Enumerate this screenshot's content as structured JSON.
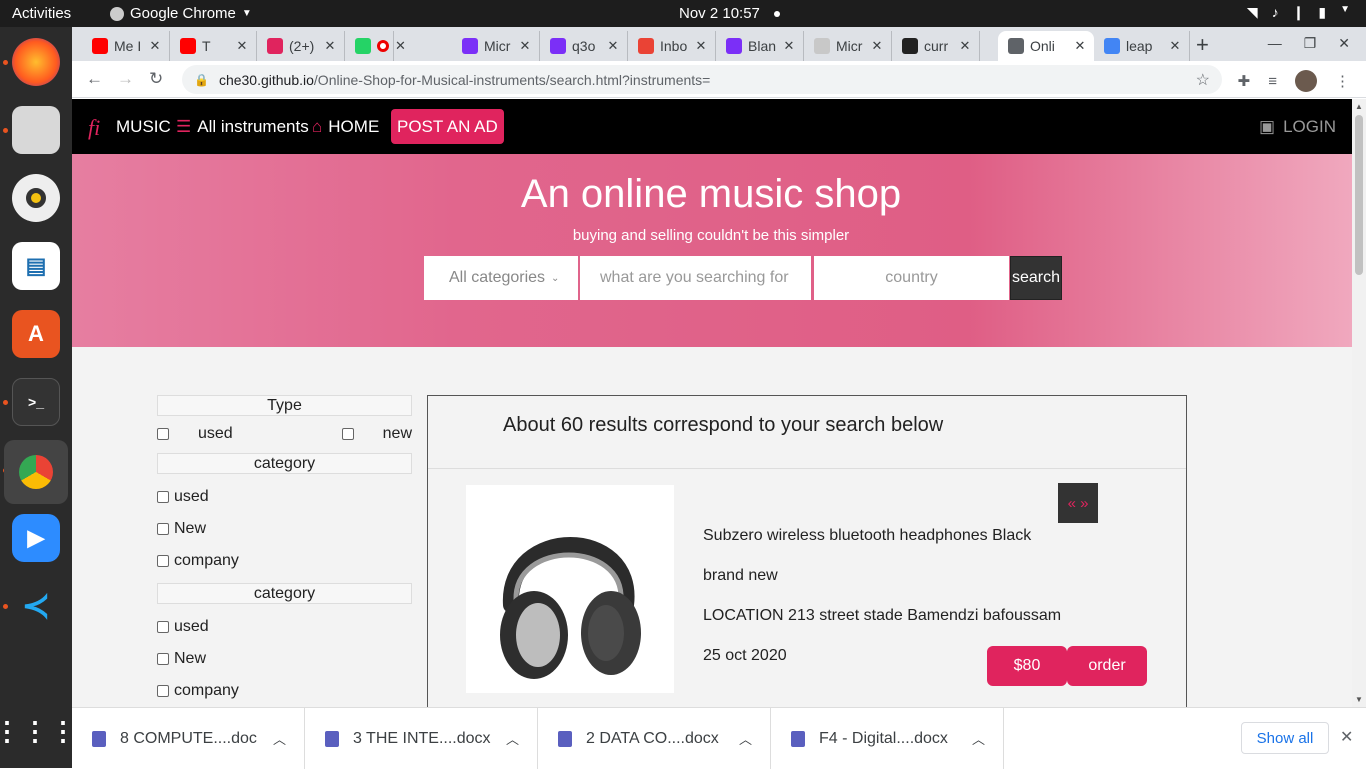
{
  "os": {
    "activities": "Activities",
    "app_name": "Google Chrome",
    "clock": "Nov 2  10:57"
  },
  "browser": {
    "tabs": [
      {
        "label": "Me I",
        "color": "#ff0000"
      },
      {
        "label": "T",
        "color": "#ff0000"
      },
      {
        "label": "(2+)",
        "color": "#e0245e"
      },
      {
        "label": "(",
        "color": "#25d366"
      },
      {
        "label": "",
        "color": "#ff0000"
      },
      {
        "label": "Micr",
        "color": "#7b2ff7"
      },
      {
        "label": "q3o",
        "color": "#7b2ff7"
      },
      {
        "label": "Inbo",
        "color": "#ea4335"
      },
      {
        "label": "Blan",
        "color": "#7b2ff7"
      },
      {
        "label": "Micr",
        "color": "#c8c8c8"
      },
      {
        "label": "curr",
        "color": "#222222"
      },
      {
        "label": "Onli",
        "color": "#5f6368"
      },
      {
        "label": "leap",
        "color": "#4285f4"
      }
    ],
    "url_host": "che30.github.io",
    "url_path": "/Online-Shop-for-Musical-instruments/search.html?instruments="
  },
  "site": {
    "logo": "fi",
    "nav": {
      "music": "MUSIC",
      "all_instruments": "All instruments",
      "home": "HOME",
      "post_ad": "POST AN AD",
      "login": "LOGIN"
    },
    "hero": {
      "title": "An online music shop",
      "subtitle": "buying and selling couldn't be this simpler"
    },
    "search": {
      "category": "All categories",
      "query_placeholder": "what are you searching for",
      "country_placeholder": "country",
      "button": "search"
    },
    "filters": {
      "type_heading": "Type",
      "type_used": "used",
      "type_new": "new",
      "category1_heading": "category",
      "category1_items": [
        "used",
        "New",
        "company"
      ],
      "category2_heading": "category",
      "category2_items": [
        "used",
        "New",
        "company"
      ]
    },
    "results": {
      "count_text": "About 60 results correspond to your search below",
      "item": {
        "title": "Subzero wireless bluetooth headphones Black",
        "condition": "brand new",
        "location": "LOCATION 213 street stade Bamendzi bafoussam",
        "date": "25 oct 2020",
        "price": "$80",
        "order": "order",
        "pager": "« »"
      }
    }
  },
  "downloads": {
    "items": [
      "8 COMPUTE....doc",
      "3 THE INTE....docx",
      "2 DATA CO....docx",
      "F4 - Digital....docx"
    ],
    "show_all": "Show all"
  },
  "colors": {
    "accent": "#e0245e",
    "hero_pink": "#df5e85"
  }
}
